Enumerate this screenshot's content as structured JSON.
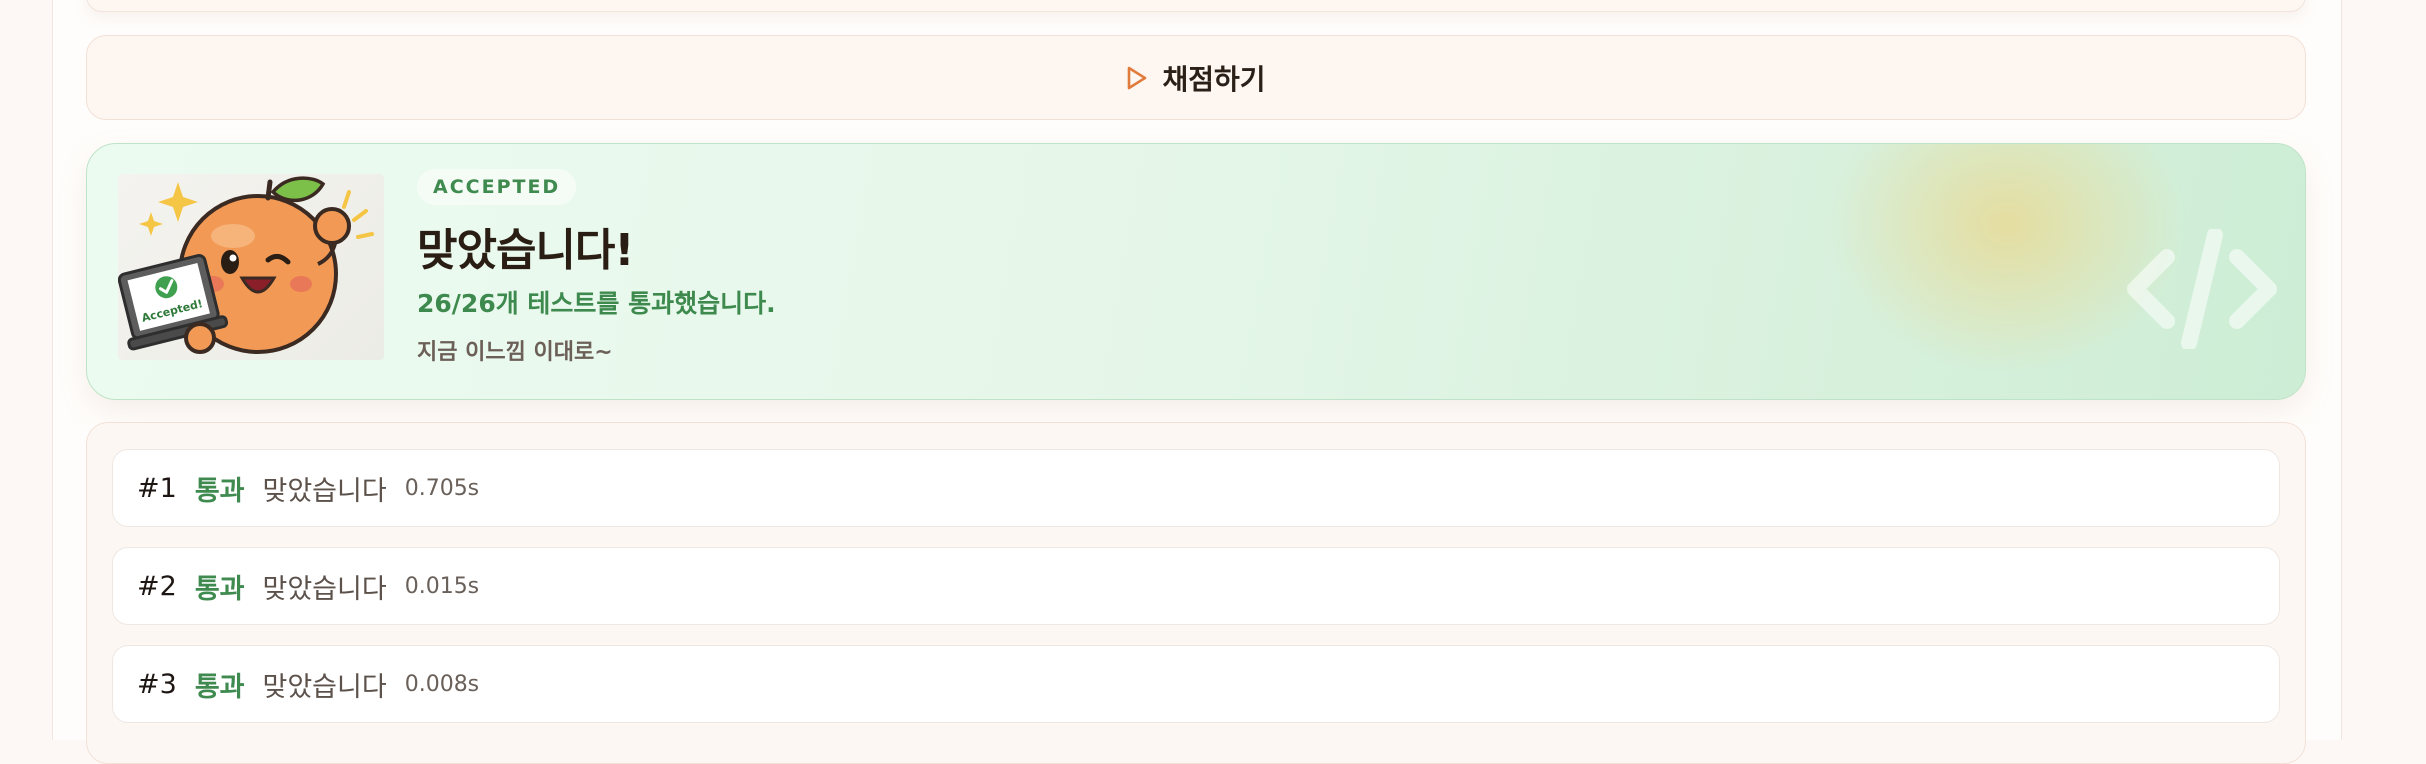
{
  "grade": {
    "label": "채점하기"
  },
  "result": {
    "badge": "ACCEPTED",
    "title": "맞았습니다!",
    "summary": "26/26개 테스트를 통과했습니다.",
    "message": "지금 이느낌 이대로~",
    "mascot_laptop_text": "Accepted!",
    "code_glyph": "</>"
  },
  "tests": [
    {
      "num": "#1",
      "status": "통과",
      "message": "맞았습니다",
      "time": "0.705s"
    },
    {
      "num": "#2",
      "status": "통과",
      "message": "맞았습니다",
      "time": "0.015s"
    },
    {
      "num": "#3",
      "status": "통과",
      "message": "맞았습니다",
      "time": "0.008s"
    }
  ],
  "colors": {
    "accent": "#e07b3c",
    "success": "#3f8a4f",
    "title": "#2a1d14"
  }
}
